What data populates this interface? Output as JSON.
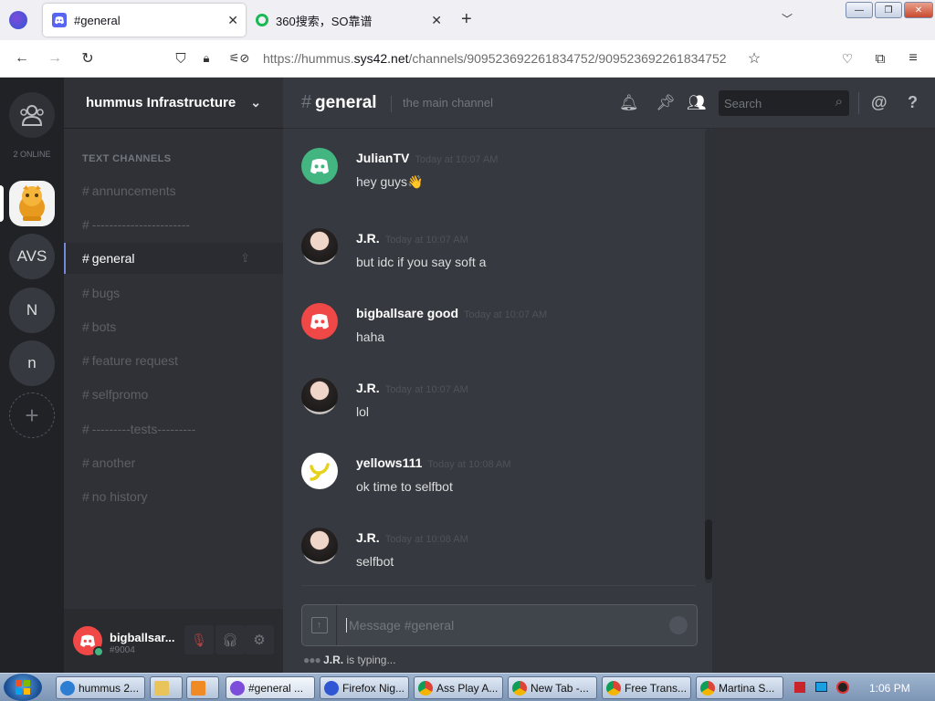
{
  "browser": {
    "tabs": [
      {
        "title": "#general",
        "active": true
      },
      {
        "title": "360搜索，SO靠谱",
        "active": false
      }
    ],
    "new_tab_label": "+",
    "url_prefix": "https://hummus.",
    "url_domain": "sys42.net",
    "url_path": "/channels/909523692261834752/909523692261834752"
  },
  "guilds": {
    "online_count": "2 ONLINE",
    "servers": [
      "AVS",
      "N",
      "n"
    ],
    "add_label": "+"
  },
  "server": {
    "name": "hummus Infrastructure",
    "category": "TEXT CHANNELS",
    "channels": [
      {
        "name": "annuncements"
      },
      {
        "name": "-----------------------"
      },
      {
        "name": "general",
        "selected": true
      },
      {
        "name": "bugs"
      },
      {
        "name": "bots"
      },
      {
        "name": "feature request"
      },
      {
        "name": "selfpromo"
      },
      {
        "name": "---------tests---------"
      },
      {
        "name": "another"
      },
      {
        "name": "no history"
      }
    ]
  },
  "user": {
    "name": "bigballsar...",
    "tag": "#9004"
  },
  "channel_header": {
    "hash": "#",
    "name": "general",
    "topic": "the main channel",
    "search_placeholder": "Search",
    "mention_label": "@",
    "help_label": "?"
  },
  "messages": [
    {
      "author": "JulianTV",
      "time": "Today at 10:07 AM",
      "text": "hey guys",
      "emoji": "👋",
      "avatar": "discord-green"
    },
    {
      "author": "J.R.",
      "time": "Today at 10:07 AM",
      "text": "but idc if you say soft a",
      "avatar": "photo"
    },
    {
      "author": "bigballsare good",
      "time": "Today at 10:07 AM",
      "text": "haha",
      "avatar": "discord-red"
    },
    {
      "author": "J.R.",
      "time": "Today at 10:07 AM",
      "text": "lol",
      "avatar": "photo"
    },
    {
      "author": "yellows111",
      "time": "Today at 10:08 AM",
      "text": "ok time to selfbot",
      "avatar": "yellow"
    },
    {
      "author": "J.R.",
      "time": "Today at 10:08 AM",
      "text": "selfbot",
      "avatar": "photo"
    }
  ],
  "composer": {
    "placeholder": "Message #general"
  },
  "typing": {
    "user": "J.R.",
    "suffix": " is typing..."
  },
  "taskbar": {
    "items": [
      "hummus 2...",
      "#general ...",
      "Firefox Nig...",
      "Ass Play A...",
      "New Tab -...",
      "Free Trans...",
      "Martina S..."
    ],
    "clock": "1:06 PM"
  },
  "colors": {
    "accent": "#7289da",
    "discord_green": "#43b581",
    "discord_red": "#f04747"
  }
}
